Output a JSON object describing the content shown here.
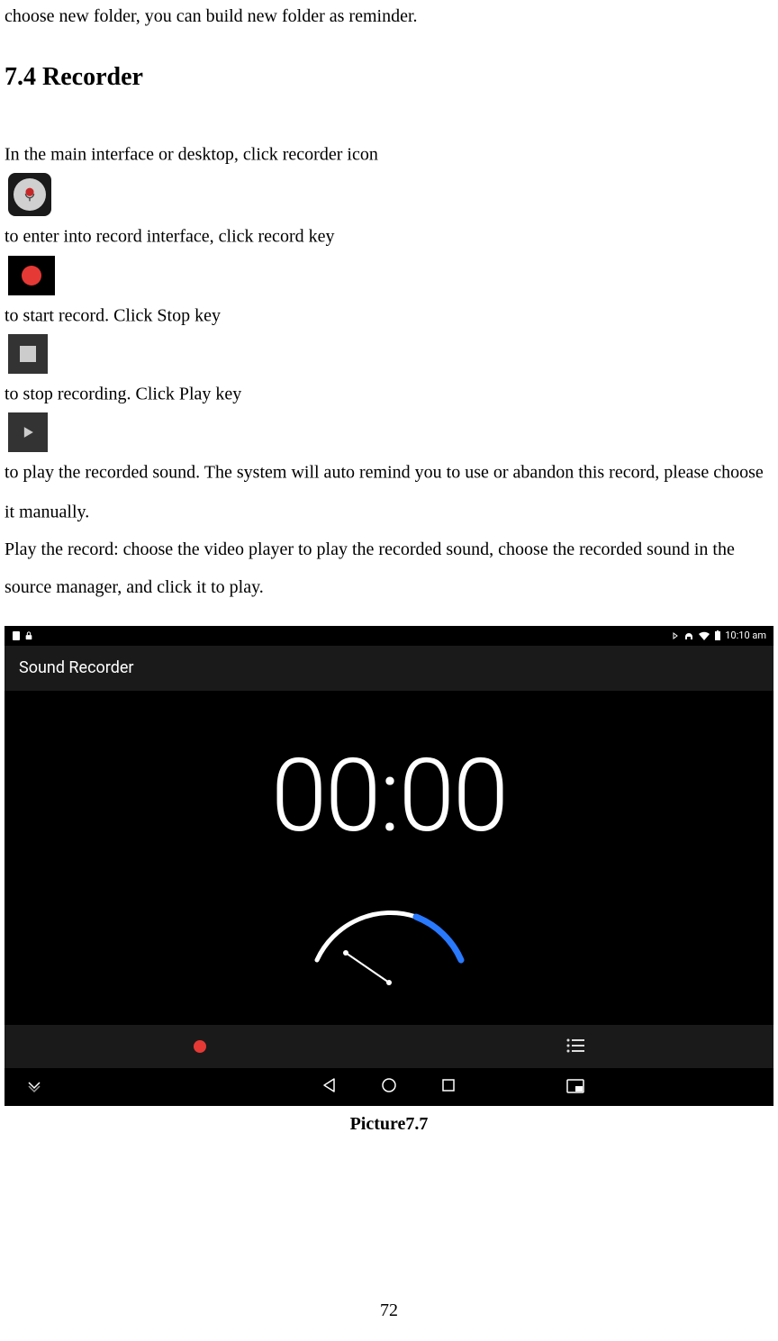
{
  "intro_line": "choose new folder, you can build new folder as reminder.",
  "heading": "7.4 Recorder",
  "para1_seg1": "In the main interface or desktop, click recorder icon ",
  "para1_seg2": " to enter into record interface, click record key ",
  "para1_seg3": " to start record. Click Stop key ",
  "para1_seg4": " to stop recording. Click Play key ",
  "para1_seg5": " to play the recorded sound. The system will auto remind you to use or abandon this record, please choose it manually.",
  "para2": "Play the record: choose the video player to play the recorded sound, choose the recorded sound in the source manager, and click it to play.",
  "screenshot": {
    "status_time": "10:10 am",
    "app_title": "Sound Recorder",
    "timer": "00:00"
  },
  "caption": "Picture7.7",
  "page_number": "72"
}
